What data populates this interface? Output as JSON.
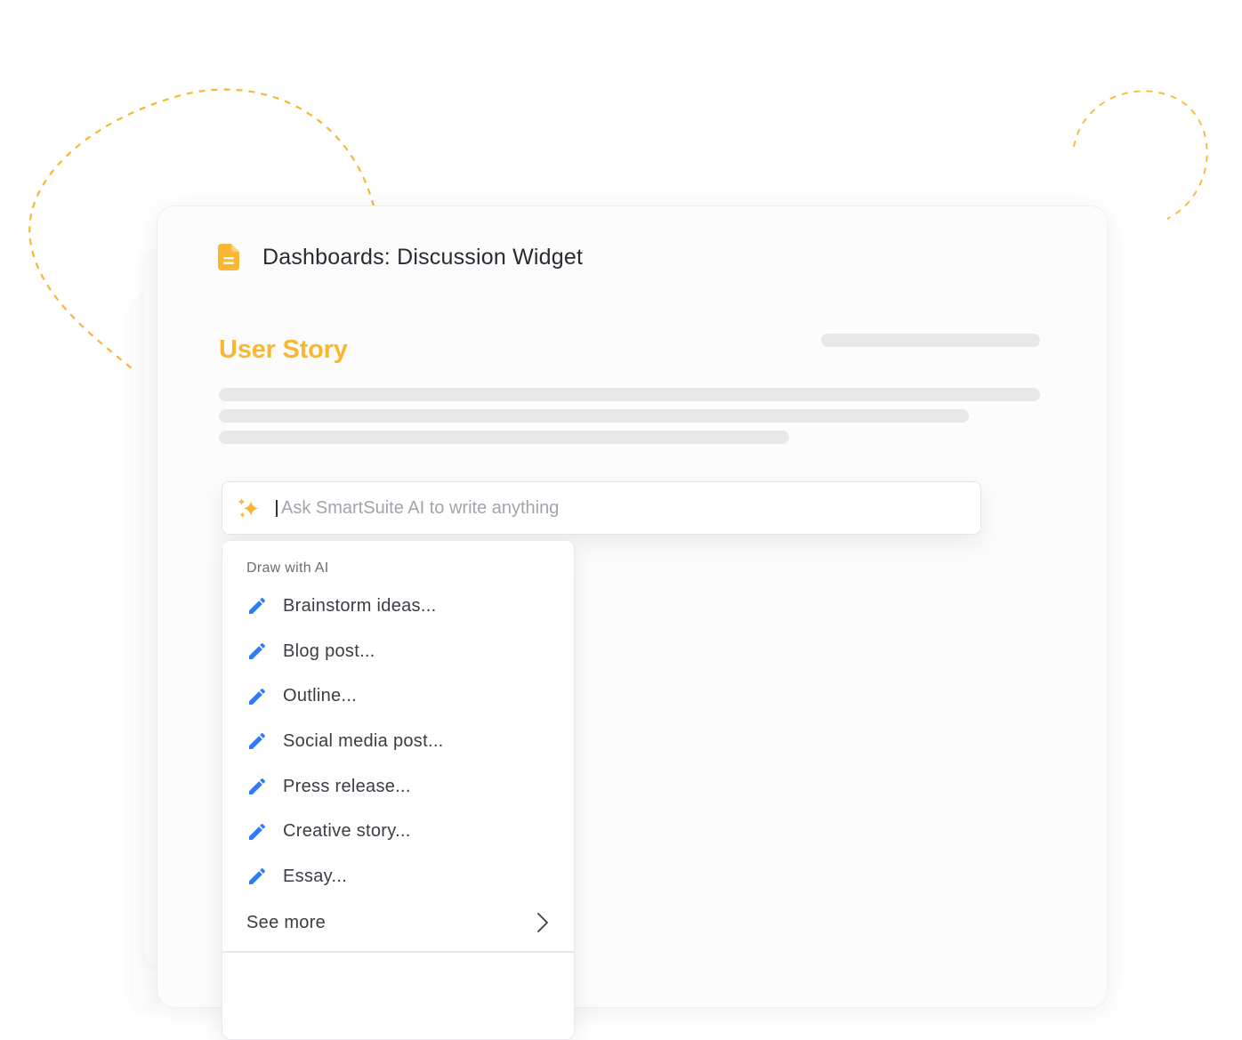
{
  "document": {
    "icon": "document-icon",
    "title": "Dashboards: Discussion Widget"
  },
  "section": {
    "title": "User Story"
  },
  "ai_prompt": {
    "icon": "sparkles-icon",
    "placeholder": "Ask SmartSuite AI to write anything",
    "value": ""
  },
  "menu": {
    "heading": "Draw with AI",
    "items": [
      {
        "label": "Brainstorm ideas...",
        "icon": "pencil-icon"
      },
      {
        "label": "Blog post...",
        "icon": "pencil-icon"
      },
      {
        "label": "Outline...",
        "icon": "pencil-icon"
      },
      {
        "label": "Social media post...",
        "icon": "pencil-icon"
      },
      {
        "label": "Press release...",
        "icon": "pencil-icon"
      },
      {
        "label": "Creative story...",
        "icon": "pencil-icon"
      },
      {
        "label": "Essay...",
        "icon": "pencil-icon"
      }
    ],
    "see_more": {
      "label": "See more",
      "icon": "chevron-right-icon"
    }
  },
  "colors": {
    "accent": "#f7b731",
    "pencil": "#2f7cf6",
    "skeleton": "#e8e7ea"
  }
}
